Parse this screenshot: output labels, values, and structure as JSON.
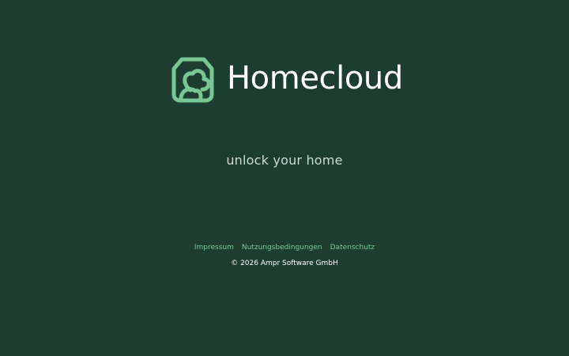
{
  "brand": {
    "name": "Homecloud",
    "logo_icon": "house-cloud-icon",
    "logo_color": "#78c694"
  },
  "tagline": "unlock your home",
  "footer": {
    "links": [
      "Impressum",
      "Nutzungsbedingungen",
      "Datenschutz"
    ],
    "link_color": "#79c896",
    "copyright": "© 2026 Ampr Software GmbH"
  },
  "colors": {
    "background": "#1d3d30",
    "text_primary": "#ffffff",
    "text_secondary": "#cfdad5"
  }
}
